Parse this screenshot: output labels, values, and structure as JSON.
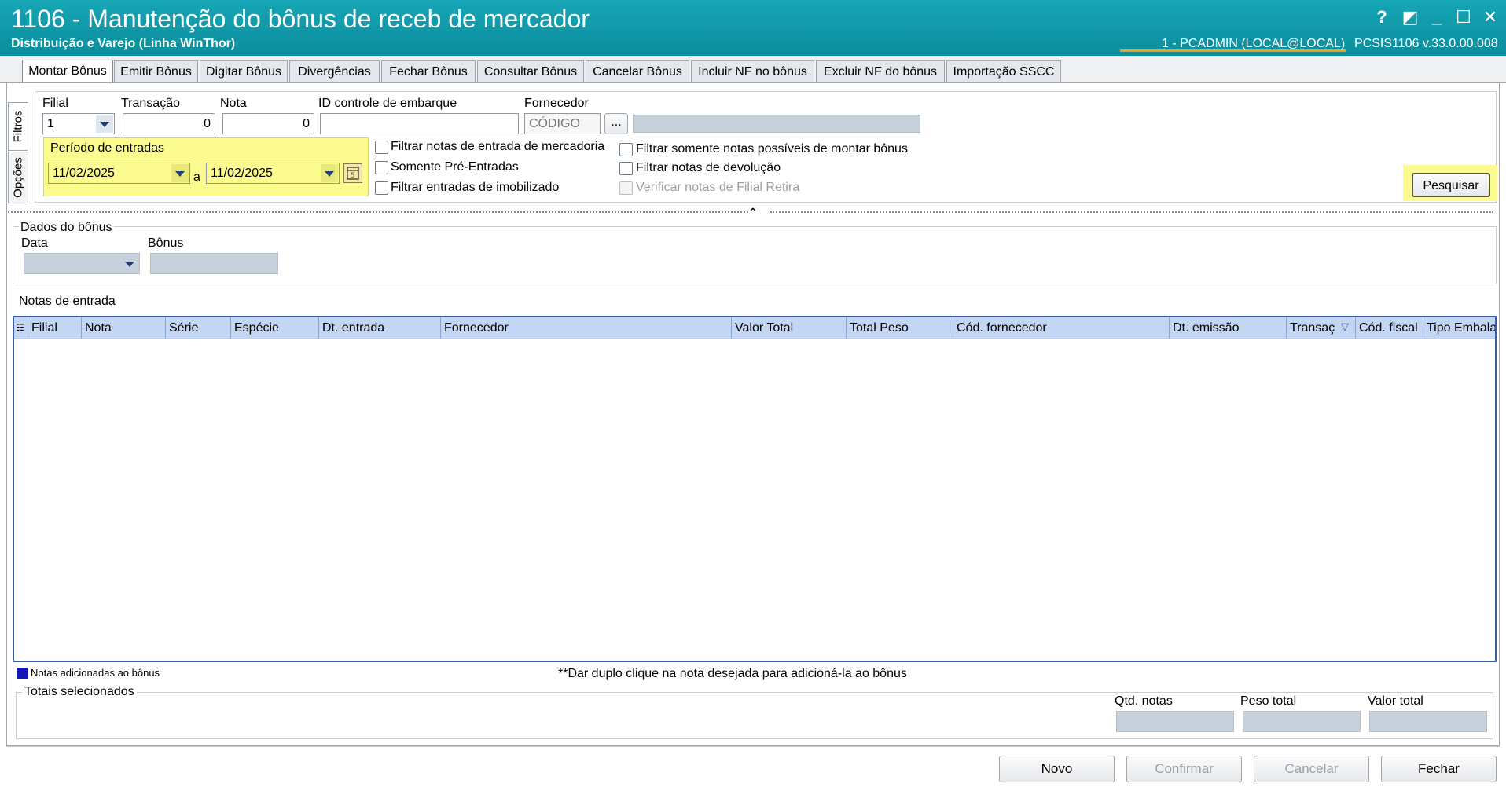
{
  "window": {
    "title": "1106 - Manutenção do bônus de receb de mercador",
    "subtitle": "Distribuição e Varejo (Linha WinThor)",
    "user": "1 - PCADMIN (LOCAL@LOCAL)",
    "version": "PCSIS1106  v.33.0.00.008",
    "controls": [
      "?",
      "◩",
      "_",
      "☐",
      "✕"
    ]
  },
  "tabs": [
    "Montar Bônus",
    "Emitir Bônus",
    "Digitar Bônus",
    "Divergências",
    "Fechar Bônus",
    "Consultar Bônus",
    "Cancelar Bônus",
    "Incluir NF no bônus",
    "Excluir NF do bônus",
    "Importação SSCC"
  ],
  "side_tabs": [
    "Filtros",
    "Opções"
  ],
  "filters": {
    "filial_label": "Filial",
    "filial_value": "1",
    "transacao_label": "Transação",
    "transacao_value": "0",
    "nota_label": "Nota",
    "nota_value": "0",
    "embarque_label": "ID controle de embarque",
    "embarque_value": "",
    "fornecedor_label": "Fornecedor",
    "fornecedor_placeholder": "CÓDIGO",
    "fornecedor_button": "...",
    "periodo_label": "Período de entradas",
    "date_from": "11/02/2025",
    "date_sep": "a",
    "date_to": "11/02/2025",
    "checkboxes": [
      {
        "label": "Filtrar notas de entrada de mercadoria",
        "checked": false,
        "enabled": true
      },
      {
        "label": "Somente Pré-Entradas",
        "checked": false,
        "enabled": true
      },
      {
        "label": "Filtrar entradas de imobilizado",
        "checked": false,
        "enabled": true
      },
      {
        "label": "Filtrar somente notas possíveis de montar bônus",
        "checked": false,
        "enabled": true
      },
      {
        "label": "Filtrar notas de devolução",
        "checked": false,
        "enabled": true
      },
      {
        "label": "Verificar notas de Filial Retira",
        "checked": false,
        "enabled": false
      }
    ],
    "search_button": "Pesquisar"
  },
  "bonus_data": {
    "group_label": "Dados do bônus",
    "data_label": "Data",
    "bonus_label": "Bônus"
  },
  "notes_grid": {
    "group_label": "Notas de entrada",
    "columns": [
      "Filial",
      "Nota",
      "Série",
      "Espécie",
      "Dt. entrada",
      "Fornecedor",
      "Valor Total",
      "Total Peso",
      "Cód. fornecedor",
      "Dt. emissão",
      "Transaç",
      "Cód. fiscal",
      "Tipo Embala"
    ],
    "rows": []
  },
  "legend": {
    "text": "Notas adicionadas ao bônus",
    "color": "#1414b8",
    "hint": "**Dar duplo clique na nota desejada para adicioná-la ao bônus"
  },
  "totals": {
    "group_label": "Totais selecionados",
    "qtd_label": "Qtd. notas",
    "peso_label": "Peso total",
    "valor_label": "Valor total"
  },
  "footer": {
    "novo": "Novo",
    "confirmar": "Confirmar",
    "cancelar": "Cancelar",
    "fechar": "Fechar"
  }
}
